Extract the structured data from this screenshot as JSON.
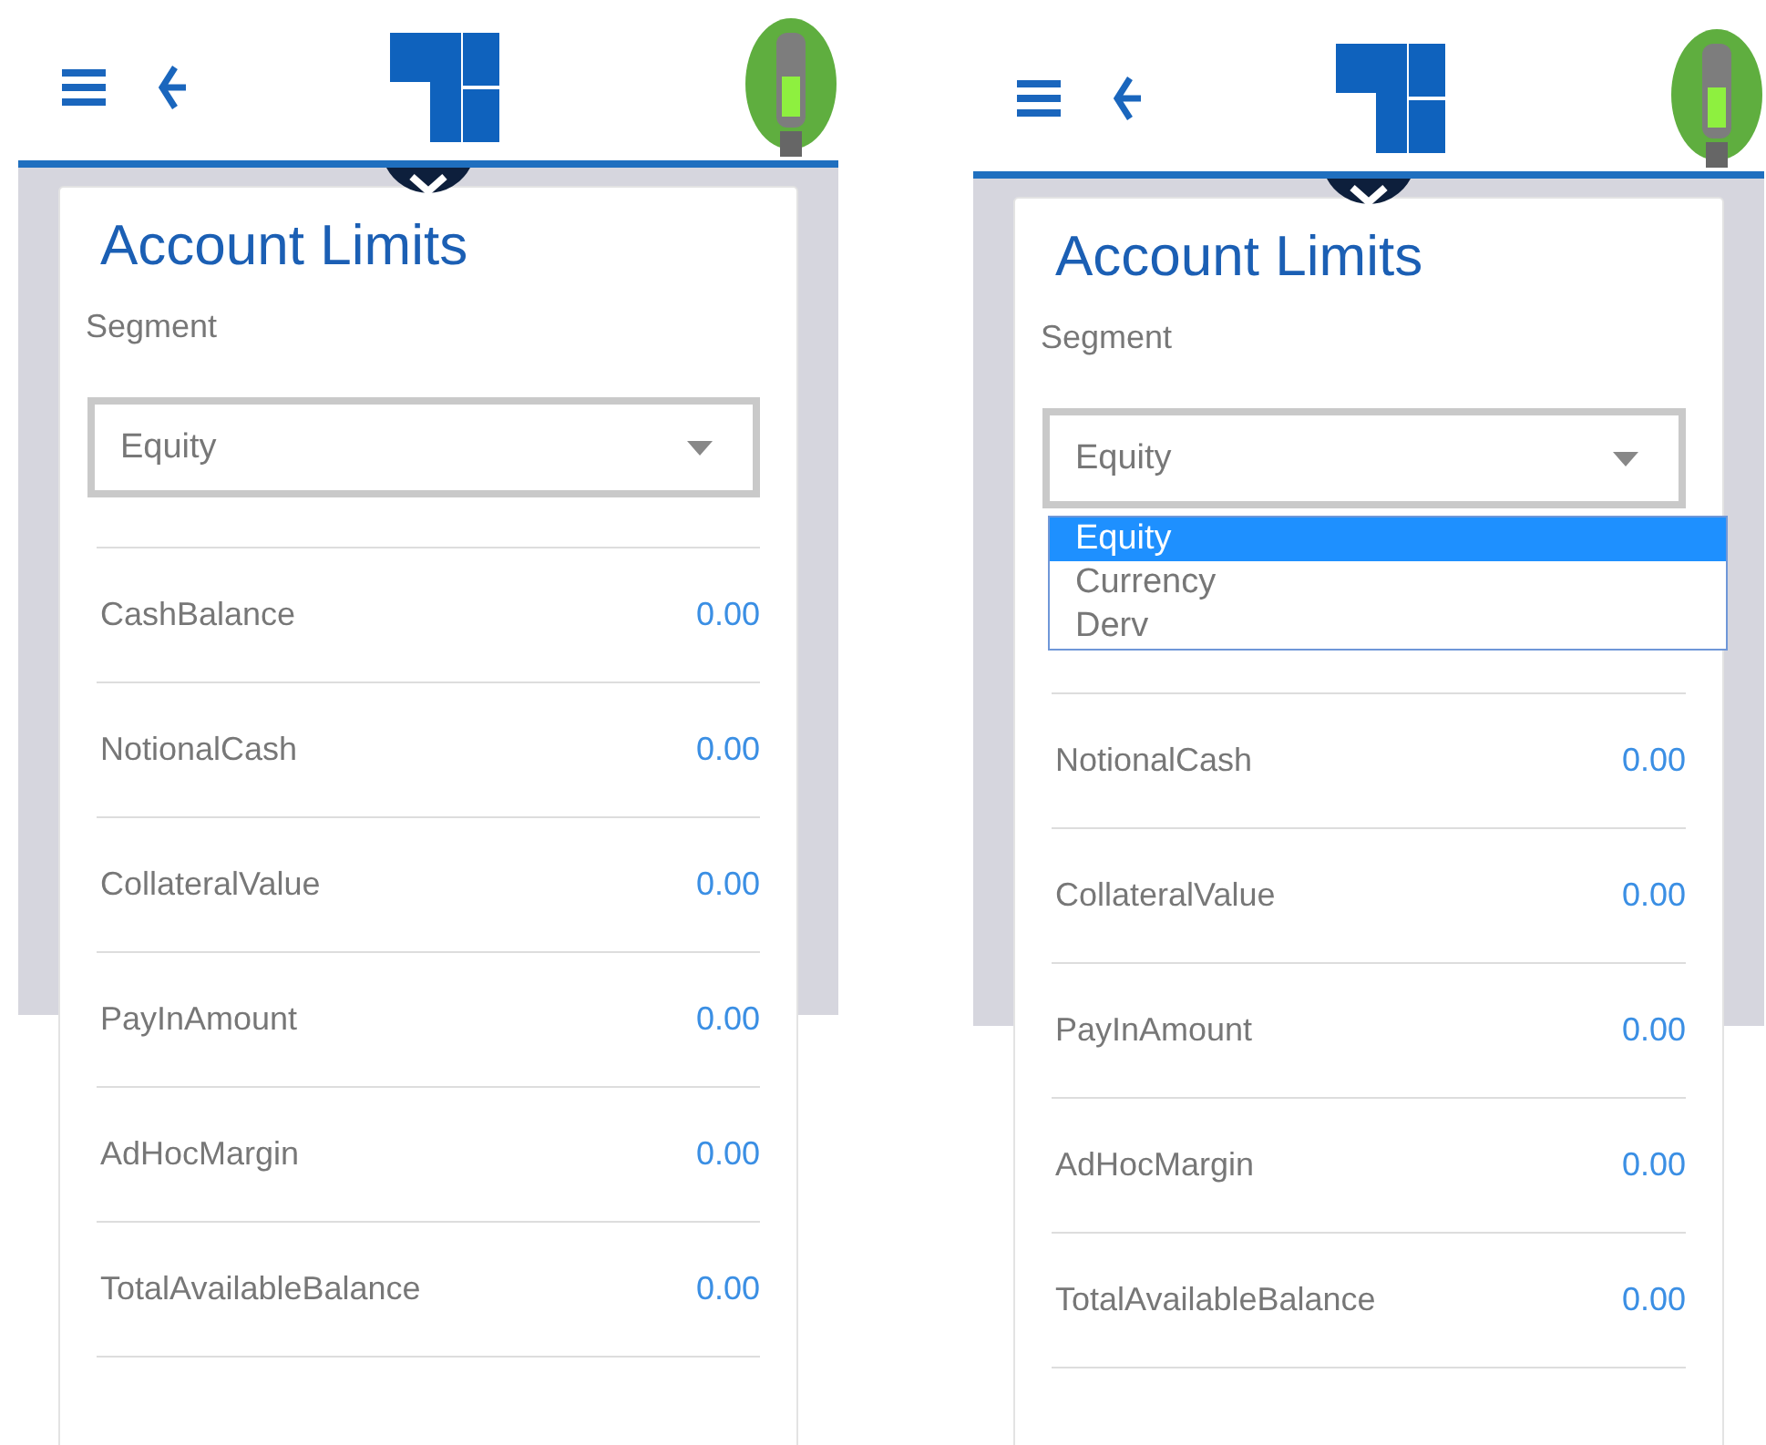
{
  "screens": [
    {
      "title": "Account Limits",
      "segment_label": "Segment",
      "select": {
        "value": "Equity"
      },
      "rows": [
        {
          "label": "CashBalance",
          "value": "0.00"
        },
        {
          "label": "NotionalCash",
          "value": "0.00"
        },
        {
          "label": "CollateralValue",
          "value": "0.00"
        },
        {
          "label": "PayInAmount",
          "value": "0.00"
        },
        {
          "label": "AdHocMargin",
          "value": "0.00"
        },
        {
          "label": "TotalAvailableBalance",
          "value": "0.00"
        }
      ]
    },
    {
      "title": "Account Limits",
      "segment_label": "Segment",
      "select": {
        "value": "Equity",
        "options": [
          {
            "label": "Equity",
            "selected": true
          },
          {
            "label": "Currency",
            "selected": false
          },
          {
            "label": "Derv",
            "selected": false
          }
        ]
      },
      "rows": [
        {
          "label": "NotionalCash",
          "value": "0.00"
        },
        {
          "label": "CollateralValue",
          "value": "0.00"
        },
        {
          "label": "PayInAmount",
          "value": "0.00"
        },
        {
          "label": "AdHocMargin",
          "value": "0.00"
        },
        {
          "label": "TotalAvailableBalance",
          "value": "0.00"
        }
      ]
    }
  ]
}
